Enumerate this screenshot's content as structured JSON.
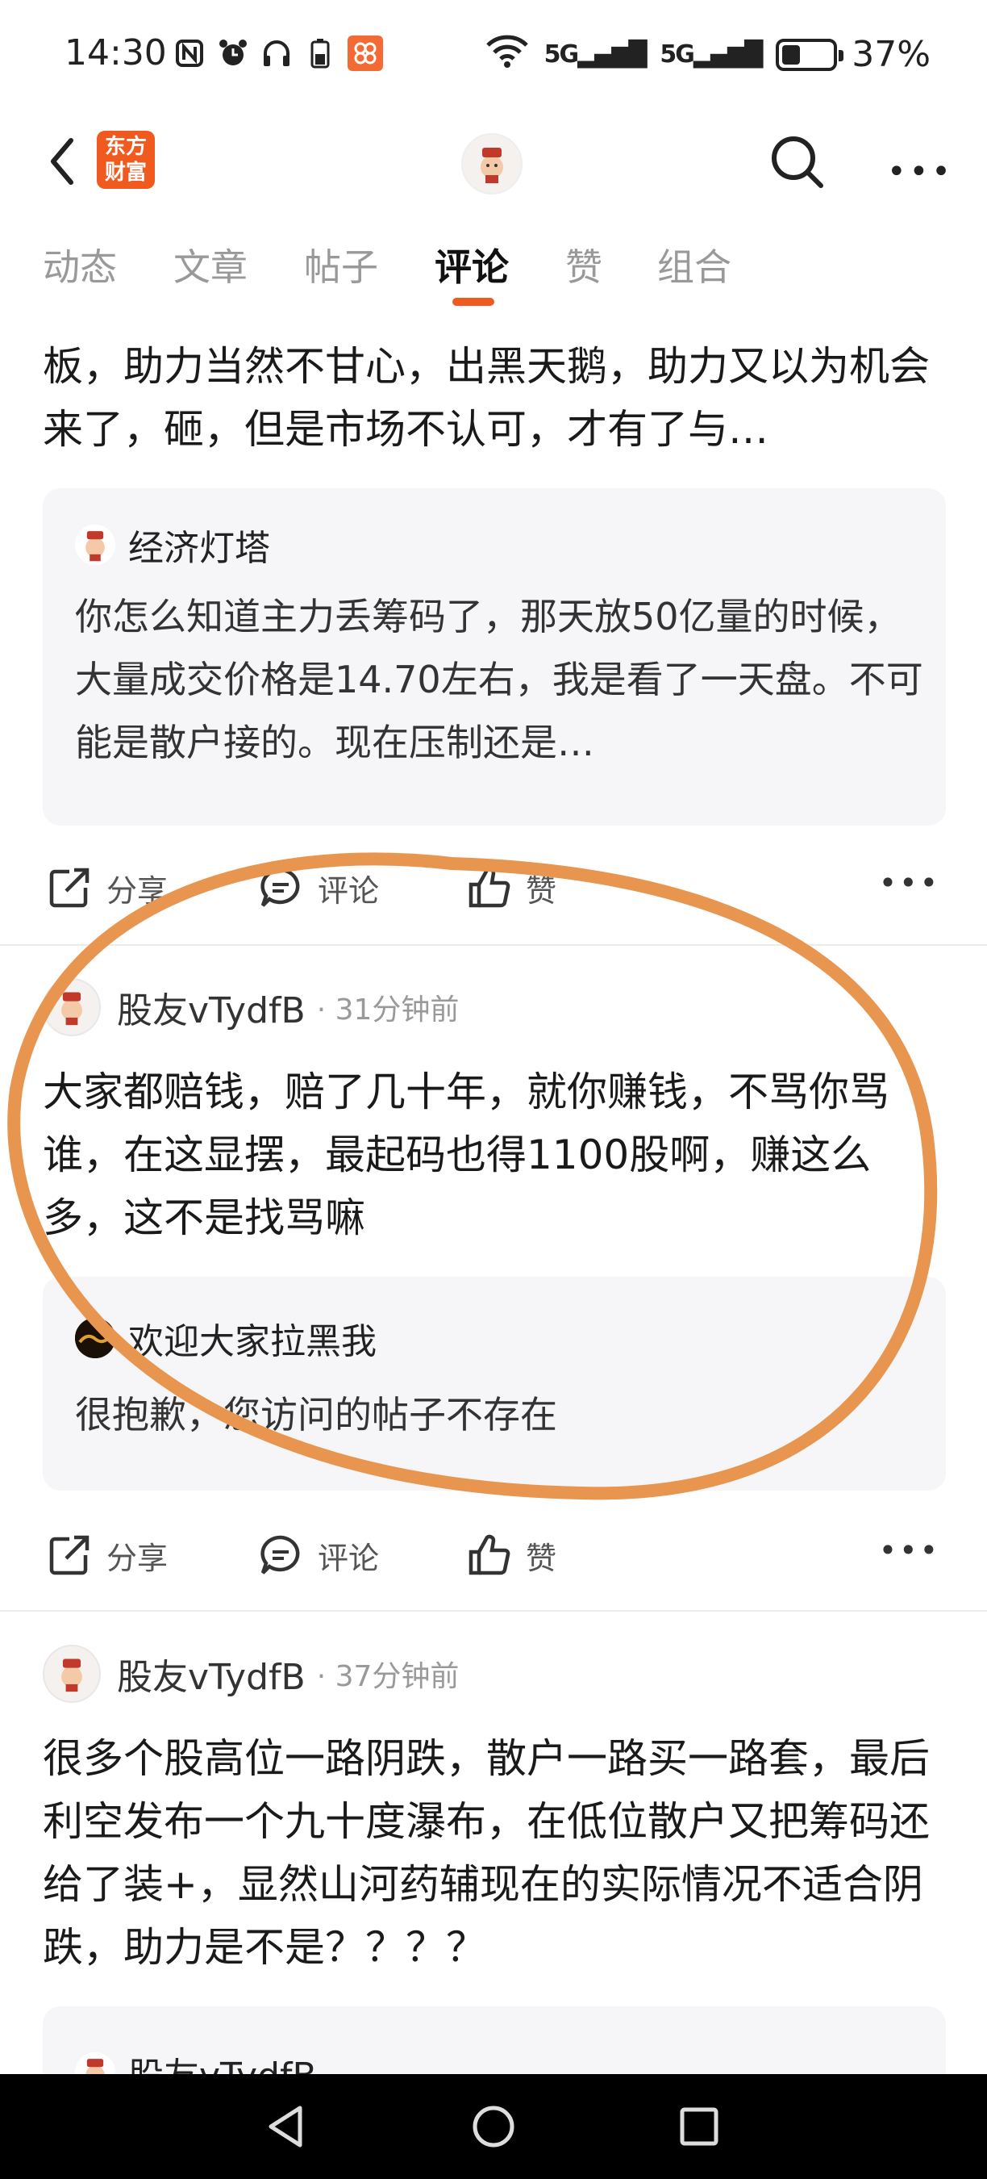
{
  "status_bar": {
    "time": "14:30",
    "battery_text": "37%",
    "battery_level": 0.37,
    "signal1": "5G",
    "signal2": "5G"
  },
  "header": {
    "app_logo_text": "东方\n财富",
    "tabs": [
      {
        "label": "动态"
      },
      {
        "label": "文章"
      },
      {
        "label": "帖子"
      },
      {
        "label": "评论",
        "active": true
      },
      {
        "label": "赞"
      },
      {
        "label": "组合"
      }
    ]
  },
  "posts": [
    {
      "body": "板，助力当然不甘心，出黑天鹅，助力又以为机会来了，砸，但是市场不认可，才有了与…",
      "quote": {
        "user": "经济灯塔",
        "body": "你怎么知道主力丢筹码了，那天放50亿量的时候，大量成交价格是14.70左右，我是看了一天盘。不可能是散户接的。现在压制还是…"
      },
      "actions": {
        "share": "分享",
        "comment": "评论",
        "like": "赞"
      }
    },
    {
      "user": "股友vTydfB",
      "time": "31分钟前",
      "body": "大家都赔钱，赔了几十年，就你赚钱，不骂你骂谁，在这显摆，最起码也得1100股啊，赚这么多，这不是找骂嘛",
      "quote": {
        "user": "欢迎大家拉黑我",
        "body": "很抱歉，您访问的帖子不存在"
      },
      "actions": {
        "share": "分享",
        "comment": "评论",
        "like": "赞"
      }
    },
    {
      "user": "股友vTydfB",
      "time": "37分钟前",
      "body": "很多个股高位一路阴跌，散户一路买一路套，最后利空发布一个九十度瀑布，在低位散户又把筹码还给了装+，显然山河药辅现在的实际情况不适合阴跌，助力是不是？？？？",
      "quote": {
        "user": "股友vTydfB"
      }
    }
  ],
  "colors": {
    "accent": "#f05a1e",
    "annotation": "#e8954f"
  }
}
